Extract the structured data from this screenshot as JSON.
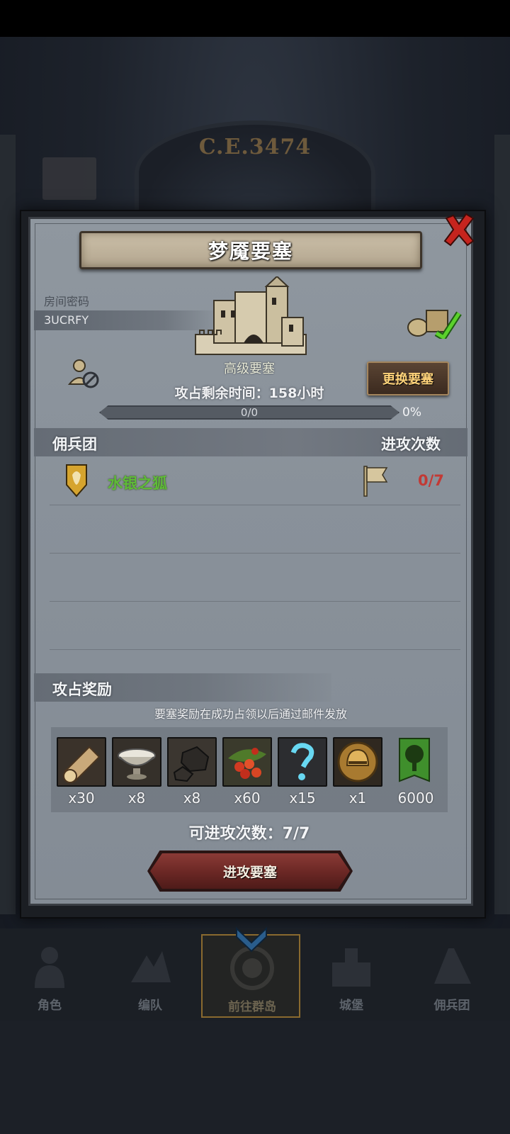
{
  "background": {
    "era_label": "C.E.3474"
  },
  "dialog": {
    "title": "梦魇要塞",
    "room_password_label": "房间密码",
    "room_code": "3UCRFY",
    "fortress_name": "高级要塞",
    "change_button": "更换要塞",
    "occupation_time_text": "攻占剩余时间：158小时",
    "progress": {
      "label": "0/0",
      "percent_text": "0%",
      "value": 0
    },
    "mercenary_header": "佣兵团",
    "attack_count_header": "进攻次数",
    "mercenary": {
      "name": "水银之狐",
      "attacks": "0/7"
    },
    "reward_header": "攻占奖励",
    "reward_note": "要塞奖励在成功占领以后通过邮件发放",
    "rewards": [
      {
        "icon": "wood-log-icon",
        "qty": "x30"
      },
      {
        "icon": "silver-bowl-icon",
        "qty": "x8"
      },
      {
        "icon": "ore-rock-icon",
        "qty": "x8"
      },
      {
        "icon": "berries-icon",
        "qty": "x60"
      },
      {
        "icon": "mystery-question-icon",
        "qty": "x15"
      },
      {
        "icon": "gold-helmet-icon",
        "qty": "x1"
      },
      {
        "icon": "tree-banner-icon",
        "qty": "6000"
      }
    ],
    "attempts_text": "可进攻次数：7/7",
    "attack_button": "进攻要塞"
  },
  "bottom_nav": [
    {
      "label": "角色",
      "icon": "knight-icon"
    },
    {
      "label": "编队",
      "icon": "formation-icon"
    },
    {
      "label": "前往群岛",
      "icon": "compass-icon",
      "active": true
    },
    {
      "label": "城堡",
      "icon": "castle-icon"
    },
    {
      "label": "佣兵团",
      "icon": "mercenary-icon"
    }
  ],
  "colors": {
    "merc_name": "#5fbb38",
    "attack_count": "#c23a35",
    "change_button_text": "#ffd37a",
    "attack_button": "#6a2724"
  }
}
